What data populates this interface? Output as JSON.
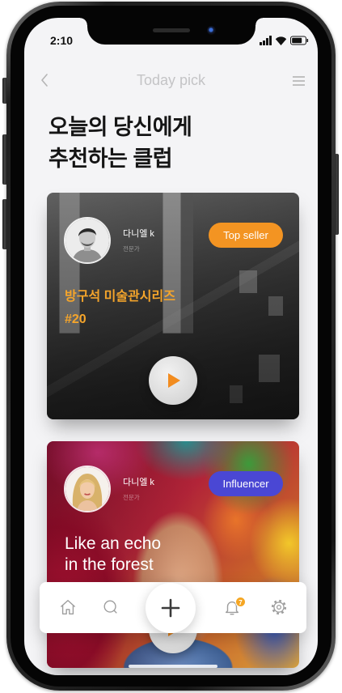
{
  "status_bar": {
    "time": "2:10",
    "icons": [
      "signal-icon",
      "wifi-icon",
      "battery-icon"
    ]
  },
  "nav": {
    "title": "Today pick",
    "back_icon": "chevron-left-icon",
    "menu_icon": "hamburger-menu-icon"
  },
  "heading": {
    "line1": "오늘의 당신에게",
    "line2": "추천하는 클럽"
  },
  "cards": [
    {
      "author_name": "다니엘 k",
      "author_role": "전문가",
      "badge": "Top seller",
      "badge_color": "#f39422",
      "title_line1": "방구석 미술관시리즈",
      "title_line2": "#20",
      "title_color": "#f5a52b",
      "action_icon": "play-icon"
    },
    {
      "author_name": "다니엘 k",
      "author_role": "전문가",
      "badge": "Influencer",
      "badge_color": "#4a47d4",
      "title_line1": "Like an echo",
      "title_line2": "in the forest",
      "title_color": "#ffffff",
      "action_icon": "play-icon"
    }
  ],
  "tab_bar": {
    "items": [
      "home-icon",
      "search-icon",
      "plus-icon",
      "bell-icon",
      "gear-icon"
    ],
    "notification_count": "7",
    "badge_color": "#f5a623"
  }
}
